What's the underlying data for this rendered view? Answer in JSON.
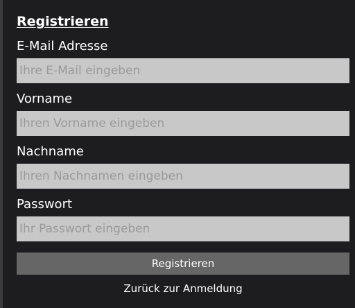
{
  "form": {
    "title": "Registrieren",
    "fields": [
      {
        "label": "E-Mail Adresse",
        "placeholder": "Ihre E-Mail eingeben",
        "value": ""
      },
      {
        "label": "Vorname",
        "placeholder": "Ihren Vorname eingeben",
        "value": ""
      },
      {
        "label": "Nachname",
        "placeholder": "Ihren Nachnamen eingeben",
        "value": ""
      },
      {
        "label": "Passwort",
        "placeholder": "Ihr Passwort eingeben",
        "value": ""
      }
    ],
    "submit_label": "Registrieren",
    "back_link_label": "Zurück zur Anmeldung"
  },
  "colors": {
    "background": "#1d1d1f",
    "input_background": "#c8c8c8",
    "button_background": "#666666",
    "text": "#ffffff",
    "placeholder": "#9a9a9a"
  }
}
